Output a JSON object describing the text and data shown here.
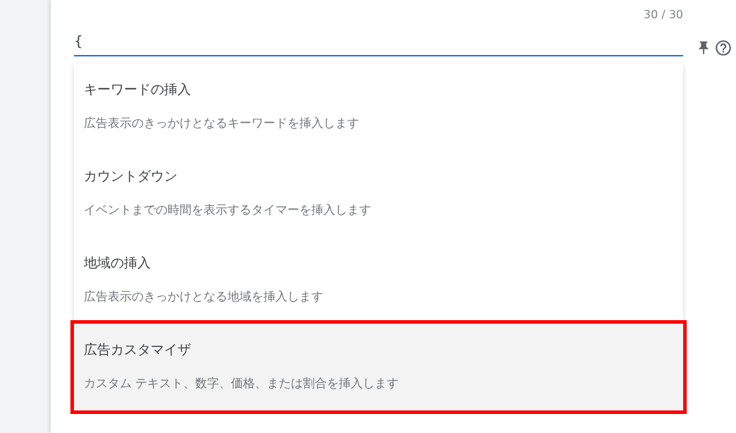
{
  "field": {
    "counter": "30 / 30",
    "value": "{",
    "focused": true
  },
  "menu": {
    "items": [
      {
        "title": "キーワードの挿入",
        "description": "広告表示のきっかけとなるキーワードを挿入します",
        "selected": false
      },
      {
        "title": "カウントダウン",
        "description": "イベントまでの時間を表示するタイマーを挿入します",
        "selected": false
      },
      {
        "title": "地域の挿入",
        "description": "広告表示のきっかけとなる地域を挿入します",
        "selected": false
      },
      {
        "title": "広告カスタマイザ",
        "description": "カスタム テキスト、数字、価格、または割合を挿入します",
        "selected": true
      }
    ]
  }
}
